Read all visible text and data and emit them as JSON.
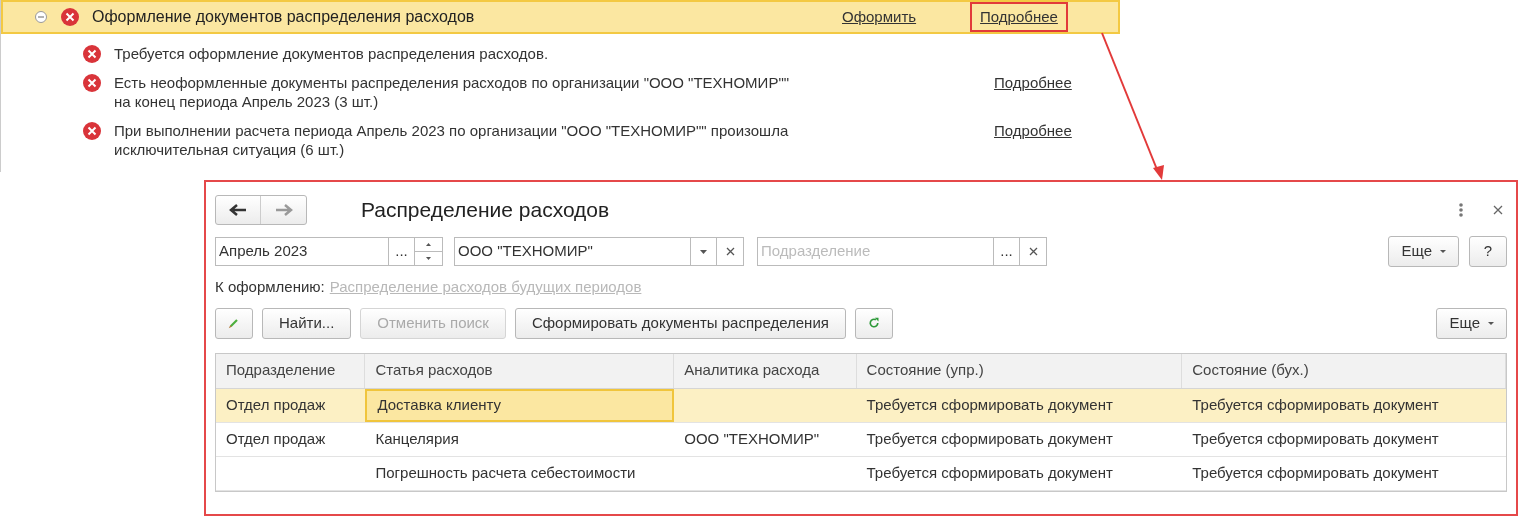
{
  "issue_group": {
    "title": "Оформление документов распределения расходов",
    "expanded": true,
    "actions": [
      {
        "label": "Оформить",
        "highlighted": false
      },
      {
        "label": "Подробнее",
        "highlighted": true
      }
    ],
    "items": [
      {
        "lines": [
          "Требуется оформление документов распределения расходов."
        ]
      },
      {
        "lines": [
          "Есть неоформленные документы распределения расходов по организации \"ООО \"ТЕХНОМИР\"\"",
          "на конец периода Апрель 2023 (3 шт.)"
        ],
        "link": "Подробнее"
      },
      {
        "lines": [
          "При выполнении расчета периода Апрель 2023 по организации \"ООО \"ТЕХНОМИР\"\" произошла",
          "исключительная ситуация (6 шт.)"
        ],
        "link": "Подробнее"
      }
    ]
  },
  "window": {
    "title": "Распределение расходов",
    "period": {
      "value": "Апрель 2023",
      "choose": "..."
    },
    "organization": {
      "value": "ООО \"ТЕХНОМИР\""
    },
    "subdivision": {
      "placeholder": "Подразделение",
      "choose": "..."
    },
    "more_top": "Еще",
    "help": "?",
    "pending_label": "К оформлению:",
    "pending_link": "Распределение расходов будущих периодов",
    "toolbar": [
      {
        "kind": "edit"
      },
      {
        "kind": "text",
        "label": "Найти...",
        "disabled": false
      },
      {
        "kind": "text",
        "label": "Отменить поиск",
        "disabled": true
      },
      {
        "kind": "text",
        "label": "Сформировать документы распределения",
        "disabled": false
      },
      {
        "kind": "refresh"
      }
    ],
    "more_toolbar": "Еще",
    "table": {
      "columns": [
        "Подразделение",
        "Статья расходов",
        "Аналитика расхода",
        "Состояние (упр.)",
        "Состояние (бух.)"
      ],
      "rows": [
        {
          "selected": true,
          "cells": [
            {
              "text": "Отдел продаж",
              "focused": false
            },
            {
              "text": "Доставка клиенту",
              "focused": true
            },
            {
              "text": "",
              "focused": false
            },
            {
              "text": "Требуется сформировать документ",
              "focused": false
            },
            {
              "text": "Требуется сформировать документ",
              "focused": false
            }
          ]
        },
        {
          "selected": false,
          "cells": [
            {
              "text": "Отдел продаж",
              "focused": false
            },
            {
              "text": "Канцелярия",
              "focused": false
            },
            {
              "text": "ООО \"ТЕХНОМИР\"",
              "focused": false
            },
            {
              "text": "Требуется сформировать документ",
              "focused": false
            },
            {
              "text": "Требуется сформировать документ",
              "focused": false
            }
          ]
        },
        {
          "selected": false,
          "cells": [
            {
              "text": "",
              "focused": false
            },
            {
              "text": "Погрешность расчета себестоимости",
              "focused": false
            },
            {
              "text": "",
              "focused": false
            },
            {
              "text": "Требуется сформировать документ",
              "focused": false
            },
            {
              "text": "Требуется сформировать документ",
              "focused": false
            }
          ]
        }
      ]
    }
  }
}
